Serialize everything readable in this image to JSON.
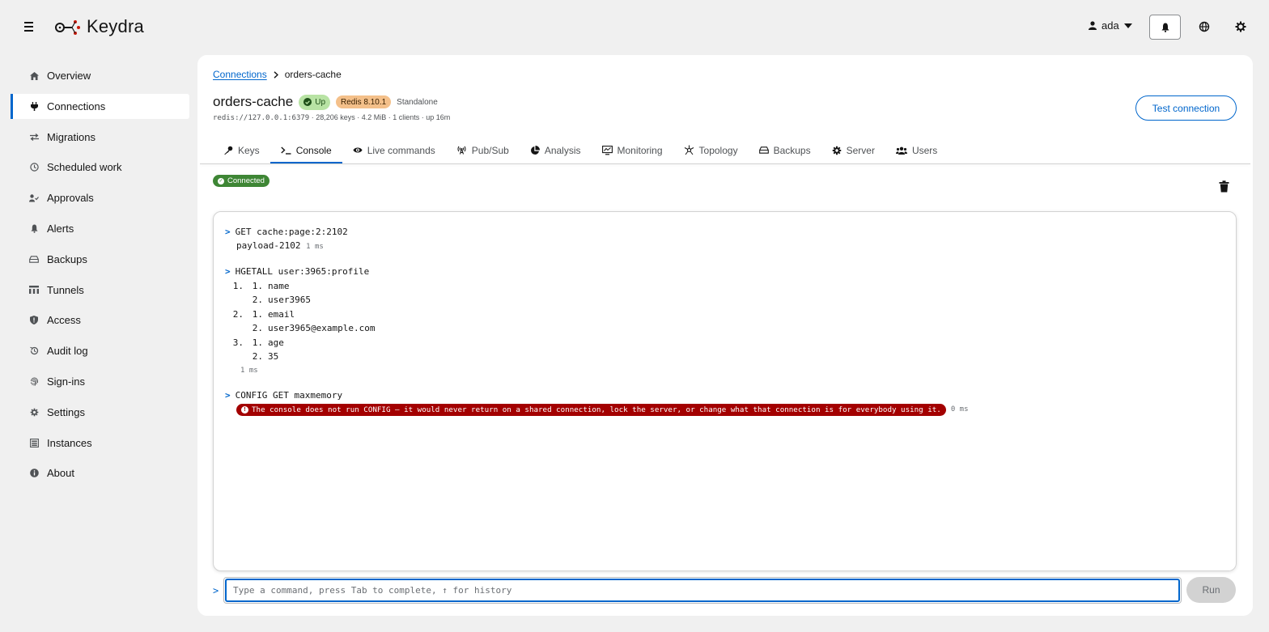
{
  "app": {
    "brand": "Keydra"
  },
  "header": {
    "user": "ada"
  },
  "sidebar": {
    "items": [
      {
        "label": "Overview",
        "icon": "home-icon"
      },
      {
        "label": "Connections",
        "icon": "plug-icon",
        "active": true
      },
      {
        "label": "Migrations",
        "icon": "exchange-icon"
      },
      {
        "label": "Scheduled work",
        "icon": "clock-icon"
      },
      {
        "label": "Approvals",
        "icon": "user-check-icon"
      },
      {
        "label": "Alerts",
        "icon": "bell-icon"
      },
      {
        "label": "Backups",
        "icon": "hdd-icon"
      },
      {
        "label": "Tunnels",
        "icon": "network-icon"
      },
      {
        "label": "Access",
        "icon": "shield-icon"
      },
      {
        "label": "Audit log",
        "icon": "history-icon"
      },
      {
        "label": "Sign-ins",
        "icon": "fingerprint-icon"
      },
      {
        "label": "Settings",
        "icon": "gear-icon"
      },
      {
        "label": "Instances",
        "icon": "server-icon"
      },
      {
        "label": "About",
        "icon": "info-icon"
      }
    ]
  },
  "breadcrumb": {
    "parent": "Connections",
    "current": "orders-cache"
  },
  "connection": {
    "name": "orders-cache",
    "status": "Up",
    "version": "Redis 8.10.1",
    "mode": "Standalone",
    "address": "redis://127.0.0.1:6379",
    "stats": " · 28,206 keys · 4.2 MiB · 1 clients · up 16m",
    "test_button": "Test connection"
  },
  "tabs": [
    {
      "label": "Keys",
      "icon": "key-icon"
    },
    {
      "label": "Console",
      "icon": "terminal-icon",
      "active": true
    },
    {
      "label": "Live commands",
      "icon": "eye-icon"
    },
    {
      "label": "Pub/Sub",
      "icon": "broadcast-icon"
    },
    {
      "label": "Analysis",
      "icon": "pie-chart-icon"
    },
    {
      "label": "Monitoring",
      "icon": "monitor-icon"
    },
    {
      "label": "Topology",
      "icon": "topology-icon"
    },
    {
      "label": "Backups",
      "icon": "hdd-icon"
    },
    {
      "label": "Server",
      "icon": "gear-icon"
    },
    {
      "label": "Users",
      "icon": "users-icon"
    }
  ],
  "console": {
    "status": "Connected",
    "entries": [
      {
        "command": "GET cache:page:2:2102",
        "result": "payload-2102",
        "time": "1 ms"
      },
      {
        "command": "HGETALL user:3965:profile",
        "rows": [
          {
            "outer": "1.",
            "inner": "1.",
            "value": "name"
          },
          {
            "outer": "",
            "inner": "2.",
            "value": "user3965"
          },
          {
            "outer": "2.",
            "inner": "1.",
            "value": "email"
          },
          {
            "outer": "",
            "inner": "2.",
            "value": "user3965@example.com"
          },
          {
            "outer": "3.",
            "inner": "1.",
            "value": "age"
          },
          {
            "outer": "",
            "inner": "2.",
            "value": "35"
          }
        ],
        "time": "1 ms"
      },
      {
        "command": "CONFIG GET maxmemory",
        "error": "The console does not run CONFIG — it would never return on a shared connection, lock the server, or change what that connection is for everybody using it.",
        "time": "0 ms"
      }
    ],
    "input_placeholder": "Type a command, press Tab to complete, ↑ for history",
    "input_value": "",
    "run_button": "Run"
  },
  "colors": {
    "accent": "#0066cc",
    "up": "#b8e3a4",
    "connected": "#3e8635",
    "error": "#a30000",
    "version": "#f4c08a"
  }
}
